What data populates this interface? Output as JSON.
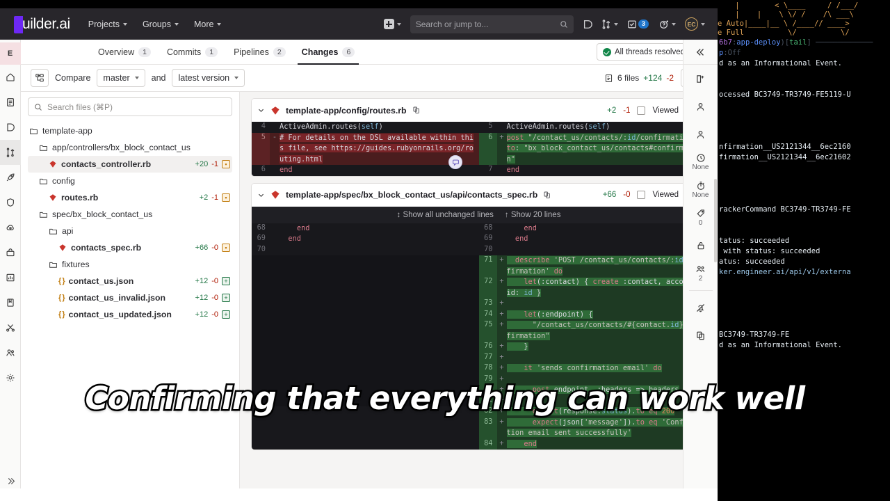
{
  "topnav": {
    "brand": "uilder.ai",
    "items": [
      {
        "label": "Projects"
      },
      {
        "label": "Groups"
      },
      {
        "label": "More"
      }
    ],
    "search_placeholder": "Search or jump to...",
    "search_value": "",
    "todo_count": "3",
    "avatar_initials": "EC"
  },
  "left_rail": {
    "project_initial": "E",
    "icons": [
      "home-icon",
      "document-icon",
      "issue-icon",
      "merge-request-icon",
      "rocket-icon",
      "shield-icon",
      "cloud-icon",
      "package-icon",
      "analytics-icon",
      "wiki-icon",
      "snippet-icon",
      "members-icon",
      "settings-icon"
    ],
    "collapse_label": "collapse-icon"
  },
  "mr_tabs": {
    "tabs": [
      {
        "label": "Overview",
        "count": "1",
        "active": false
      },
      {
        "label": "Commits",
        "count": "1",
        "active": false
      },
      {
        "label": "Pipelines",
        "count": "2",
        "active": false
      },
      {
        "label": "Changes",
        "count": "6",
        "active": true
      }
    ],
    "threads_label": "All threads resolved"
  },
  "compare_bar": {
    "compare_label": "Compare",
    "source_branch": "master",
    "and_label": "and",
    "target_version": "latest version",
    "files_count": "6 files",
    "additions": "+124",
    "deletions": "-2"
  },
  "file_tree": {
    "search_placeholder": "Search files (⌘P)",
    "search_value": "",
    "rows": [
      {
        "type": "folder",
        "indent": 0,
        "name": "template-app"
      },
      {
        "type": "folder",
        "indent": 1,
        "name": "app/controllers/bx_block_contact_us"
      },
      {
        "type": "ruby",
        "indent": 2,
        "name": "contacts_controller.rb",
        "add": "+20",
        "del": "-1",
        "chip": "mod",
        "selected": true
      },
      {
        "type": "folder",
        "indent": 1,
        "name": "config"
      },
      {
        "type": "ruby",
        "indent": 2,
        "name": "routes.rb",
        "add": "+2",
        "del": "-1",
        "chip": "mod"
      },
      {
        "type": "folder",
        "indent": 1,
        "name": "spec/bx_block_contact_us"
      },
      {
        "type": "folder",
        "indent": 2,
        "name": "api"
      },
      {
        "type": "ruby",
        "indent": 3,
        "name": "contacts_spec.rb",
        "add": "+66",
        "del": "-0",
        "chip": "mod"
      },
      {
        "type": "folder",
        "indent": 2,
        "name": "fixtures"
      },
      {
        "type": "json",
        "indent": 3,
        "name": "contact_us.json",
        "add": "+12",
        "del": "-0",
        "chip": "add"
      },
      {
        "type": "json",
        "indent": 3,
        "name": "contact_us_invalid.json",
        "add": "+12",
        "del": "-0",
        "chip": "add"
      },
      {
        "type": "json",
        "indent": 3,
        "name": "contact_us_updated.json",
        "add": "+12",
        "del": "-0",
        "chip": "add"
      }
    ]
  },
  "diffs": [
    {
      "path": "template-app/config/routes.rb",
      "additions": "+2",
      "deletions": "-1",
      "viewed_label": "Viewed",
      "left_lines": [
        {
          "num": "4",
          "sign": "",
          "kind": "ctx",
          "text": "ActiveAdmin.routes(self)"
        },
        {
          "num": "5",
          "sign": "-",
          "kind": "del",
          "text": "# For details on the DSL available within this file, see https://guides.rubyonrails.org/routing.html"
        },
        {
          "num": "6",
          "sign": "",
          "kind": "ctx",
          "text": "end"
        }
      ],
      "right_lines": [
        {
          "num": "5",
          "sign": "",
          "kind": "ctx",
          "text": "ActiveAdmin.routes(self)"
        },
        {
          "num": "6",
          "sign": "+",
          "kind": "add",
          "text": "post \"/contact_us/contacts/:id/confirmation\", to: \"bx_block_contact_us/contacts#confirmation\""
        },
        {
          "num": "7",
          "sign": "",
          "kind": "ctx",
          "text": "end"
        }
      ]
    },
    {
      "path": "template-app/spec/bx_block_contact_us/api/contacts_spec.rb",
      "additions": "+66",
      "deletions": "-0",
      "viewed_label": "Viewed",
      "expand_all_label": "Show all unchanged lines",
      "expand_20_label": "Show 20 lines",
      "left_lines": [
        {
          "num": "68",
          "sign": "",
          "kind": "ctx",
          "text": "    end"
        },
        {
          "num": "69",
          "sign": "",
          "kind": "ctx",
          "text": "  end"
        },
        {
          "num": "70",
          "sign": "",
          "kind": "ctx",
          "text": ""
        },
        {
          "num": "",
          "sign": "",
          "kind": "empty",
          "text": ""
        },
        {
          "num": "",
          "sign": "",
          "kind": "empty",
          "text": ""
        },
        {
          "num": "",
          "sign": "",
          "kind": "empty",
          "text": ""
        },
        {
          "num": "",
          "sign": "",
          "kind": "empty",
          "text": ""
        },
        {
          "num": "",
          "sign": "",
          "kind": "empty",
          "text": ""
        },
        {
          "num": "",
          "sign": "",
          "kind": "empty",
          "text": ""
        },
        {
          "num": "",
          "sign": "",
          "kind": "empty",
          "text": ""
        },
        {
          "num": "",
          "sign": "",
          "kind": "empty",
          "text": ""
        },
        {
          "num": "",
          "sign": "",
          "kind": "empty",
          "text": ""
        },
        {
          "num": "",
          "sign": "",
          "kind": "empty",
          "text": ""
        },
        {
          "num": "",
          "sign": "",
          "kind": "empty",
          "text": ""
        },
        {
          "num": "",
          "sign": "",
          "kind": "empty",
          "text": ""
        },
        {
          "num": "",
          "sign": "",
          "kind": "empty",
          "text": ""
        },
        {
          "num": "",
          "sign": "",
          "kind": "empty",
          "text": ""
        }
      ],
      "right_lines": [
        {
          "num": "68",
          "sign": "",
          "kind": "ctx",
          "text": "    end"
        },
        {
          "num": "69",
          "sign": "",
          "kind": "ctx",
          "text": "  end"
        },
        {
          "num": "70",
          "sign": "",
          "kind": "ctx",
          "text": ""
        },
        {
          "num": "71",
          "sign": "+",
          "kind": "add",
          "text": "  describe 'POST /contact_us/contacts/:id/confirmation' do"
        },
        {
          "num": "72",
          "sign": "+",
          "kind": "add",
          "text": "    let(:contact) { create :contact, account_id: id }"
        },
        {
          "num": "73",
          "sign": "+",
          "kind": "add",
          "text": ""
        },
        {
          "num": "74",
          "sign": "+",
          "kind": "add",
          "text": "    let(:endpoint) {"
        },
        {
          "num": "75",
          "sign": "+",
          "kind": "add",
          "text": "      \"/contact_us/contacts/#{contact.id}/confirmation\""
        },
        {
          "num": "76",
          "sign": "+",
          "kind": "add",
          "text": "    }"
        },
        {
          "num": "77",
          "sign": "+",
          "kind": "add",
          "text": ""
        },
        {
          "num": "78",
          "sign": "+",
          "kind": "add",
          "text": "    it 'sends confirmation email' do"
        },
        {
          "num": "79",
          "sign": "+",
          "kind": "add",
          "text": ""
        },
        {
          "num": "80",
          "sign": "+",
          "kind": "add",
          "text": "      post endpoint, :headers => headers"
        },
        {
          "num": "81",
          "sign": "+",
          "kind": "add",
          "text": ""
        },
        {
          "num": "82",
          "sign": "+",
          "kind": "add",
          "text": "      expect(response.status).to eq 200"
        },
        {
          "num": "83",
          "sign": "+",
          "kind": "add",
          "text": "      expect(json['message']).to eq 'Confirmation email sent successfully'"
        },
        {
          "num": "84",
          "sign": "+",
          "kind": "add",
          "text": "    end"
        }
      ]
    }
  ],
  "right_rail": {
    "collapse_icon": "chevrons-left-icon",
    "items": [
      {
        "icon": "new-branch-icon",
        "value": ""
      },
      {
        "icon": "assignee-icon",
        "value": ""
      },
      {
        "icon": "reviewer-icon",
        "value": ""
      },
      {
        "icon": "milestone-icon",
        "value": "None"
      },
      {
        "icon": "time-tracking-icon",
        "value": "None"
      },
      {
        "icon": "labels-icon",
        "value": "0"
      },
      {
        "icon": "lock-icon",
        "value": ""
      },
      {
        "icon": "participants-icon",
        "value": "2"
      },
      {
        "icon": "notifications-off-icon",
        "value": ""
      },
      {
        "icon": "copy-reference-icon",
        "value": ""
      }
    ]
  },
  "terminal": {
    "ascii": [
      "    |        < \\____     / /___/",
      "    |    |    \\ \\/ /    /\\ ___\\",
      "e Auto|____|__ \\ /____// ____>",
      "e Full          \\/          \\/"
    ],
    "lines": [
      {
        "segments": [
          {
            "t": "6b7",
            "c": "t-mag"
          },
          {
            "t": ":",
            "c": "t-dim"
          },
          {
            "t": "app-deploy",
            "c": "t-blue"
          },
          {
            "t": ")[",
            "c": "t-dim"
          },
          {
            "t": "tail",
            "c": "t-grn"
          },
          {
            "t": "] ─────────────",
            "c": "t-dim"
          }
        ]
      },
      {
        "segments": [
          {
            "t": "p",
            "c": "t-blue"
          },
          {
            "t": ":Off",
            "c": "t-dim"
          }
        ]
      },
      {
        "segments": [
          {
            "t": "d as an Informational Event.",
            "c": "t-wht"
          }
        ]
      },
      {
        "segments": [
          {
            "t": "",
            "c": "t-wht"
          }
        ]
      },
      {
        "segments": [
          {
            "t": "",
            "c": "t-wht"
          }
        ]
      },
      {
        "segments": [
          {
            "t": "ocessed BC3749-TR3749-FE5119-U",
            "c": "t-wht"
          }
        ]
      },
      {
        "segments": [
          {
            "t": "",
            "c": "t-wht"
          }
        ]
      },
      {
        "segments": [
          {
            "t": "",
            "c": "t-wht"
          }
        ]
      },
      {
        "segments": [
          {
            "t": "",
            "c": "t-wht"
          }
        ]
      },
      {
        "segments": [
          {
            "t": "",
            "c": "t-wht"
          }
        ]
      },
      {
        "segments": [
          {
            "t": "nfirmation__US2121344__6ec2160",
            "c": "t-wht"
          }
        ]
      },
      {
        "segments": [
          {
            "t": "firmation__US2121344__6ec21602",
            "c": "t-wht"
          }
        ]
      },
      {
        "segments": [
          {
            "t": "",
            "c": "t-wht"
          }
        ]
      },
      {
        "segments": [
          {
            "t": "",
            "c": "t-wht"
          }
        ]
      },
      {
        "segments": [
          {
            "t": "",
            "c": "t-wht"
          }
        ]
      },
      {
        "segments": [
          {
            "t": "",
            "c": "t-wht"
          }
        ]
      },
      {
        "segments": [
          {
            "t": "rackerCommand BC3749-TR3749-FE",
            "c": "t-wht"
          }
        ]
      },
      {
        "segments": [
          {
            "t": "",
            "c": "t-wht"
          }
        ]
      },
      {
        "segments": [
          {
            "t": "",
            "c": "t-wht"
          }
        ]
      },
      {
        "segments": [
          {
            "t": "tatus: succeeded",
            "c": "t-wht"
          }
        ]
      },
      {
        "segments": [
          {
            "t": " with status: succeeded",
            "c": "t-wht"
          }
        ]
      },
      {
        "segments": [
          {
            "t": "atus: succeeded",
            "c": "t-wht"
          }
        ]
      },
      {
        "segments": [
          {
            "t": "ker.engineer.ai/api/v1/externa",
            "c": "t-cy"
          }
        ]
      },
      {
        "segments": [
          {
            "t": "",
            "c": "t-wht"
          }
        ]
      },
      {
        "segments": [
          {
            "t": "",
            "c": "t-wht"
          }
        ]
      },
      {
        "segments": [
          {
            "t": "",
            "c": "t-wht"
          }
        ]
      },
      {
        "segments": [
          {
            "t": "",
            "c": "t-wht"
          }
        ]
      },
      {
        "segments": [
          {
            "t": "",
            "c": "t-wht"
          }
        ]
      },
      {
        "segments": [
          {
            "t": "BC3749-TR3749-FE",
            "c": "t-wht"
          }
        ]
      },
      {
        "segments": [
          {
            "t": "d as an Informational Event.",
            "c": "t-wht"
          }
        ]
      }
    ]
  },
  "caption": {
    "text": "Confirming that everything can work well"
  }
}
